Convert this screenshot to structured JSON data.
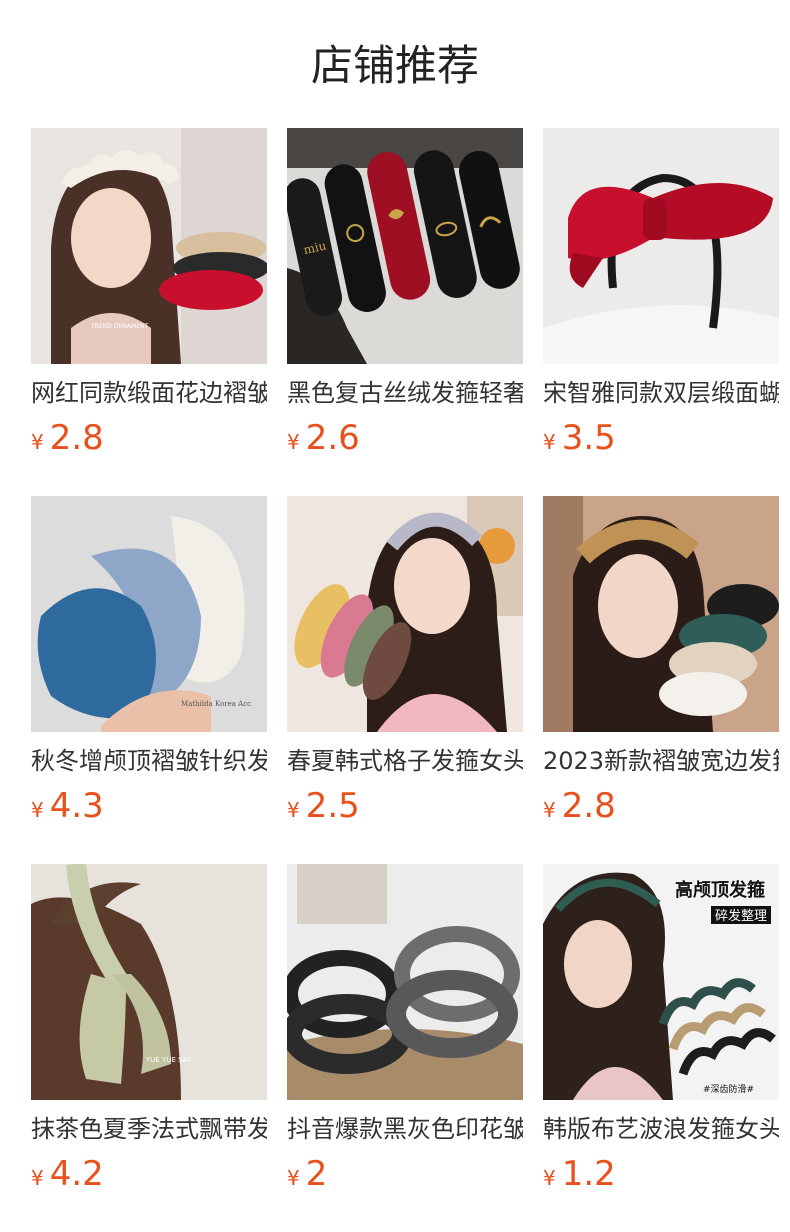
{
  "header": {
    "title": "店铺推荐"
  },
  "currency_symbol": "¥",
  "products": [
    {
      "title": "网红同款缎面花边褶皱",
      "price": "2.8",
      "image_icon": "ruffle-headband-model-image",
      "thumb_text": "TREND ORNAMENT"
    },
    {
      "title": "黑色复古丝绒发箍轻奢",
      "price": "2.6",
      "image_icon": "velvet-logo-headbands-image",
      "thumb_text": ""
    },
    {
      "title": "宋智雅同款双层缎面蝴",
      "price": "3.5",
      "image_icon": "red-bow-headband-image",
      "thumb_text": ""
    },
    {
      "title": "秋冬增颅顶褶皱针织发",
      "price": "4.3",
      "image_icon": "knit-headbands-image",
      "thumb_text": "Mathilda Korea Acc"
    },
    {
      "title": "春夏韩式格子发箍女头",
      "price": "2.5",
      "image_icon": "plaid-headband-model-image",
      "thumb_text": ""
    },
    {
      "title": "2023新款褶皱宽边发箍",
      "price": "2.8",
      "image_icon": "pleated-headband-model-image",
      "thumb_text": ""
    },
    {
      "title": "抹茶色夏季法式飘带发",
      "price": "4.2",
      "image_icon": "ribbon-headband-image",
      "thumb_text": "YUE YUE SAY"
    },
    {
      "title": "抖音爆款黑灰色印花皱",
      "price": "2",
      "image_icon": "gray-print-headbands-image",
      "thumb_text": ""
    },
    {
      "title": "韩版布艺波浪发箍女头",
      "price": "1.2",
      "image_icon": "wave-headband-model-image",
      "thumb_text": "高颅顶发箍",
      "thumb_subtext": "碎发整理",
      "thumb_footer": "#深齿防滑#"
    }
  ]
}
